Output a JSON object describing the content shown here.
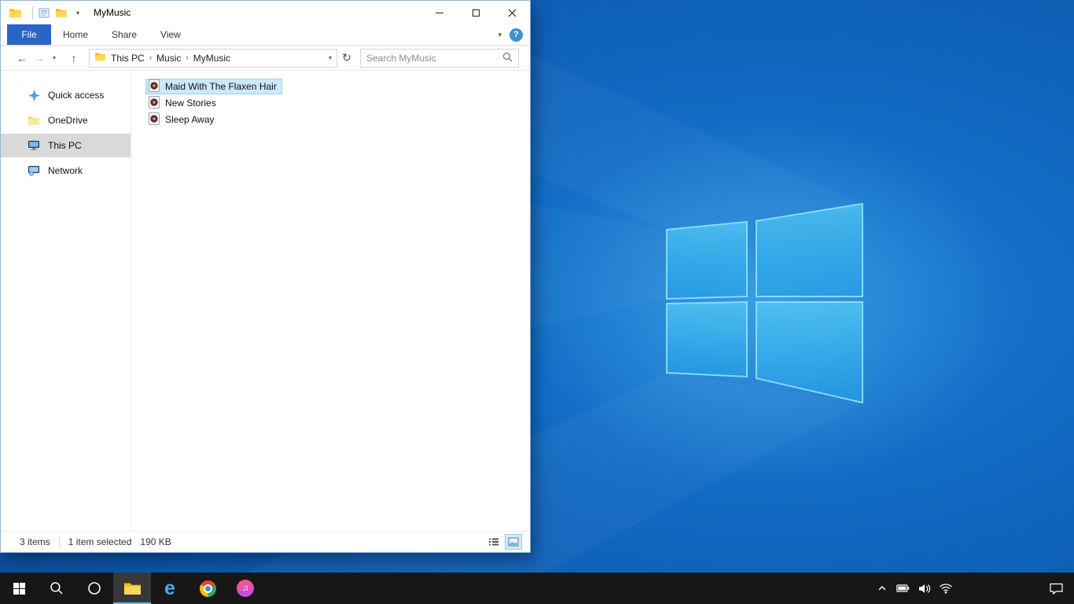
{
  "titlebar": {
    "title": "MyMusic"
  },
  "ribbon": {
    "file_tab": "File",
    "tabs": [
      "Home",
      "Share",
      "View"
    ],
    "help": "?"
  },
  "addressbar": {
    "breadcrumb": [
      "This PC",
      "Music",
      "MyMusic"
    ],
    "search_placeholder": "Search MyMusic"
  },
  "sidebar": {
    "items": [
      {
        "label": "Quick access",
        "selected": false
      },
      {
        "label": "OneDrive",
        "selected": false
      },
      {
        "label": "This PC",
        "selected": true
      },
      {
        "label": "Network",
        "selected": false
      }
    ]
  },
  "files": {
    "items": [
      {
        "name": "Maid With The Flaxen Hair",
        "type": "audio",
        "selected": true
      },
      {
        "name": "New Stories",
        "type": "audio",
        "selected": false
      },
      {
        "name": "Sleep Away",
        "type": "audio",
        "selected": false
      }
    ]
  },
  "statusbar": {
    "item_count": "3 items",
    "selection": "1 item selected",
    "selection_size": "190 KB"
  },
  "glyphs": {
    "back": "←",
    "forward": "→",
    "up": "↑",
    "refresh": "↻",
    "dropdown": "▾",
    "crumb_sep": "›",
    "collapse_ribbon": "▾",
    "qat_dropdown": "▾",
    "edge": "e",
    "itunes_note": "♫"
  },
  "taskbar": {
    "buttons": [
      "start",
      "search",
      "cortana",
      "file-explorer",
      "edge",
      "chrome",
      "itunes"
    ],
    "tray": [
      "hidden-icons-chevron",
      "battery",
      "volume",
      "network",
      "action-center"
    ]
  },
  "colors": {
    "accent": "#0078d7",
    "file_tab_blue": "#2a65c5",
    "selection_bg": "#cce8ff",
    "selection_border": "#99d1ff",
    "sidebar_selected": "#d9d9d9",
    "taskbar_bg": "#171717",
    "wallpaper_base": "#0f64bd",
    "logo_blue": "#3fc0f5"
  }
}
